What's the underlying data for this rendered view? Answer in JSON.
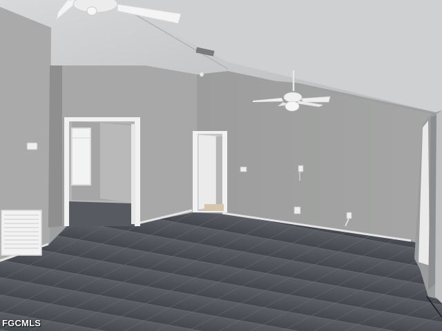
{
  "watermark": {
    "text": "FGCMLS"
  },
  "colors": {
    "wall": "#a9aaa9",
    "wall_shadow": "#8f908f",
    "ceiling": "#c9cacb",
    "floor": "#4c4f55",
    "grout": "#6b6e73",
    "baseboard": "#e6e6e6",
    "door": "#e9e9e9",
    "window_light": "#f2f3f3"
  },
  "objects": [
    {
      "name": "ceiling-fan",
      "count": 2
    },
    {
      "name": "doorway",
      "count": 2
    },
    {
      "name": "window",
      "count": 1
    },
    {
      "name": "air-vent",
      "count": 1
    },
    {
      "name": "thermostat",
      "count": 1
    },
    {
      "name": "wall-outlet",
      "count": 3
    },
    {
      "name": "curtain",
      "count": 1
    }
  ]
}
